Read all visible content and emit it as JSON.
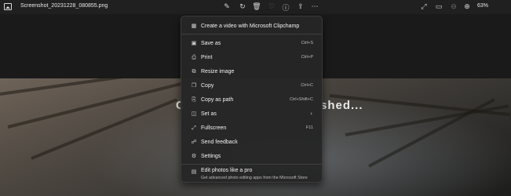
{
  "window": {
    "file_name": "Screenshot_20231228_080855.png",
    "zoom_level": "63%"
  },
  "toolbar": {
    "left_icons": [
      "edit-image-icon",
      "rotate-icon",
      "delete-icon",
      "favorite-icon",
      "info-icon",
      "share-icon",
      "more-options-icon"
    ],
    "right_icons": [
      "fullscreen-icon",
      "slideshow-icon",
      "zoom-out-icon",
      "zoom-in-icon"
    ]
  },
  "photo": {
    "caption_left": "C",
    "caption_right": "shed..."
  },
  "menu": {
    "items": [
      {
        "label": "Create a video with Microsoft Clipchamp",
        "shortcut": "",
        "icon": "video-icon"
      },
      {
        "label": "Save as",
        "shortcut": "Ctrl+S",
        "icon": "save-icon"
      },
      {
        "label": "Print",
        "shortcut": "Ctrl+P",
        "icon": "print-icon"
      },
      {
        "label": "Resize image",
        "shortcut": "",
        "icon": "resize-icon"
      },
      {
        "label": "Copy",
        "shortcut": "Ctrl+C",
        "icon": "copy-icon"
      },
      {
        "label": "Copy as path",
        "shortcut": "Ctrl+Shift+C",
        "icon": "copy-path-icon"
      },
      {
        "label": "Set as",
        "shortcut": "",
        "icon": "set-as-icon",
        "submenu": true
      },
      {
        "label": "Fullscreen",
        "shortcut": "F11",
        "icon": "fullscreen-icon"
      },
      {
        "label": "Send feedback",
        "shortcut": "",
        "icon": "feedback-icon"
      },
      {
        "label": "Settings",
        "shortcut": "",
        "icon": "gear-icon"
      }
    ],
    "promo": {
      "title": "Edit photos like a pro",
      "subtitle": "Get advanced photo editing apps from the Microsoft Store",
      "icon": "store-icon"
    }
  }
}
